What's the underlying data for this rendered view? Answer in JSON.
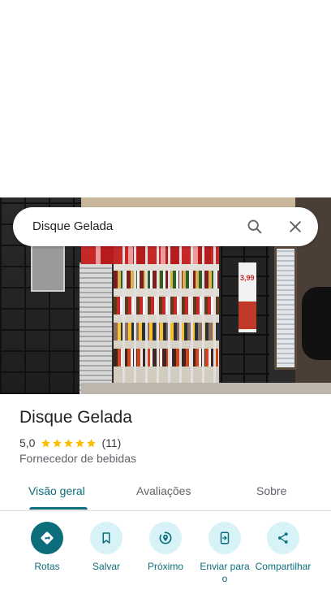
{
  "search": {
    "query": "Disque Gelada",
    "search_icon": "search-icon",
    "close_icon": "close-icon"
  },
  "photo": {
    "price_sign": "3,99"
  },
  "place": {
    "name": "Disque Gelada",
    "rating": "5,0",
    "stars": 5,
    "review_count": "(11)",
    "category": "Fornecedor de bebidas"
  },
  "tabs": [
    {
      "label": "Visão geral",
      "active": true
    },
    {
      "label": "Avaliações",
      "active": false
    },
    {
      "label": "Sobre",
      "active": false
    }
  ],
  "actions": [
    {
      "label": "Rotas",
      "icon": "directions-icon"
    },
    {
      "label": "Salvar",
      "icon": "bookmark-icon"
    },
    {
      "label": "Próximo",
      "icon": "nearby-icon"
    },
    {
      "label": "Enviar para o",
      "icon": "send-to-phone-icon"
    },
    {
      "label": "Compartilhar",
      "icon": "share-icon"
    }
  ],
  "colors": {
    "accent": "#0b6e7a",
    "accent_light": "#d8f3f8",
    "star": "#fbbc04"
  }
}
